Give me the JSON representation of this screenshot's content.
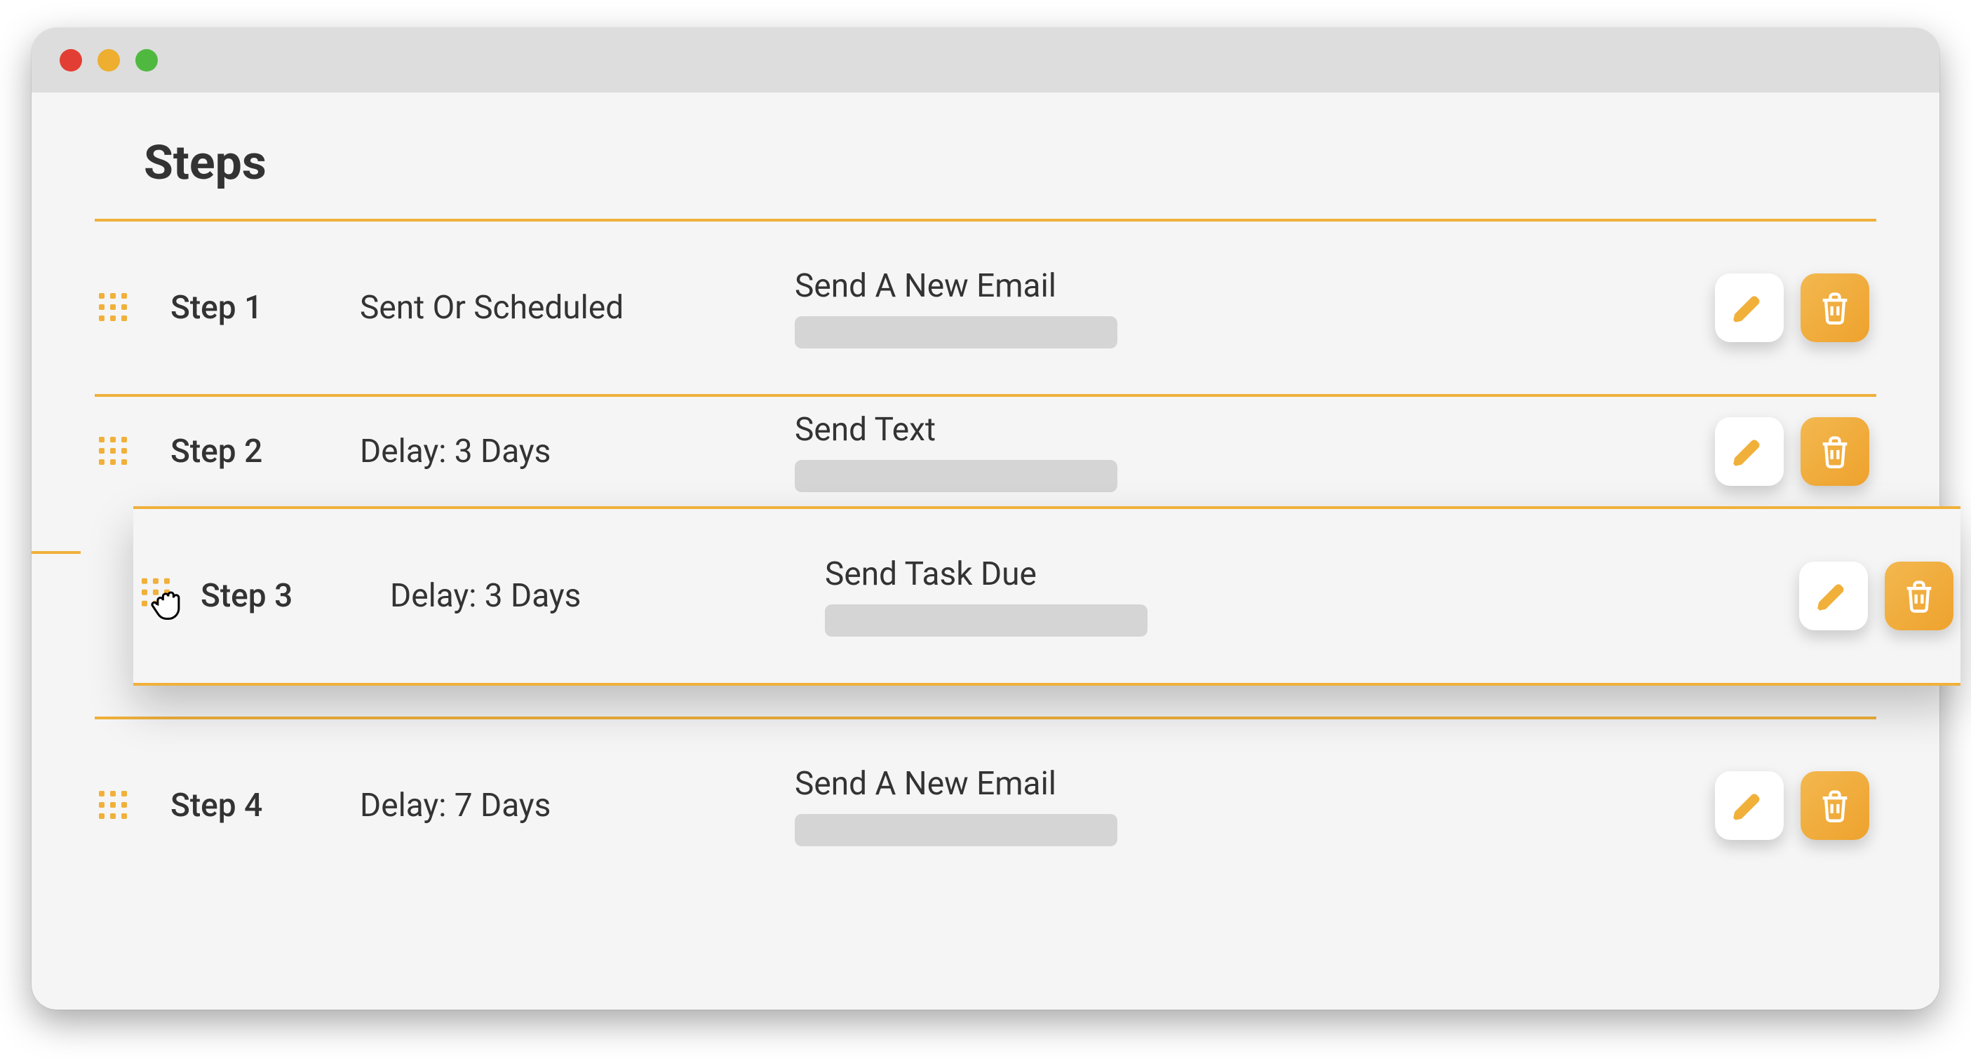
{
  "window": {
    "traffic_colors": {
      "red": "#e33e33",
      "yellow": "#eeae2f",
      "green": "#4fb93f"
    }
  },
  "page_title": "Steps",
  "accent_color": "#f0b03a",
  "steps": [
    {
      "name": "Step 1",
      "delay": "Sent Or Scheduled",
      "action": "Send A New Email"
    },
    {
      "name": "Step 2",
      "delay": "Delay: 3 Days",
      "action": "Send Text"
    },
    {
      "name": "Step 3",
      "delay": "Delay: 3 Days",
      "action": "Send Task Due"
    },
    {
      "name": "Step 4",
      "delay": "Delay: 7 Days",
      "action": "Send A New Email"
    }
  ],
  "icons": {
    "drag": "drag-handle-icon",
    "edit": "pencil-icon",
    "delete": "trash-icon",
    "grab": "grab-cursor-icon"
  },
  "dragging_index": 2
}
